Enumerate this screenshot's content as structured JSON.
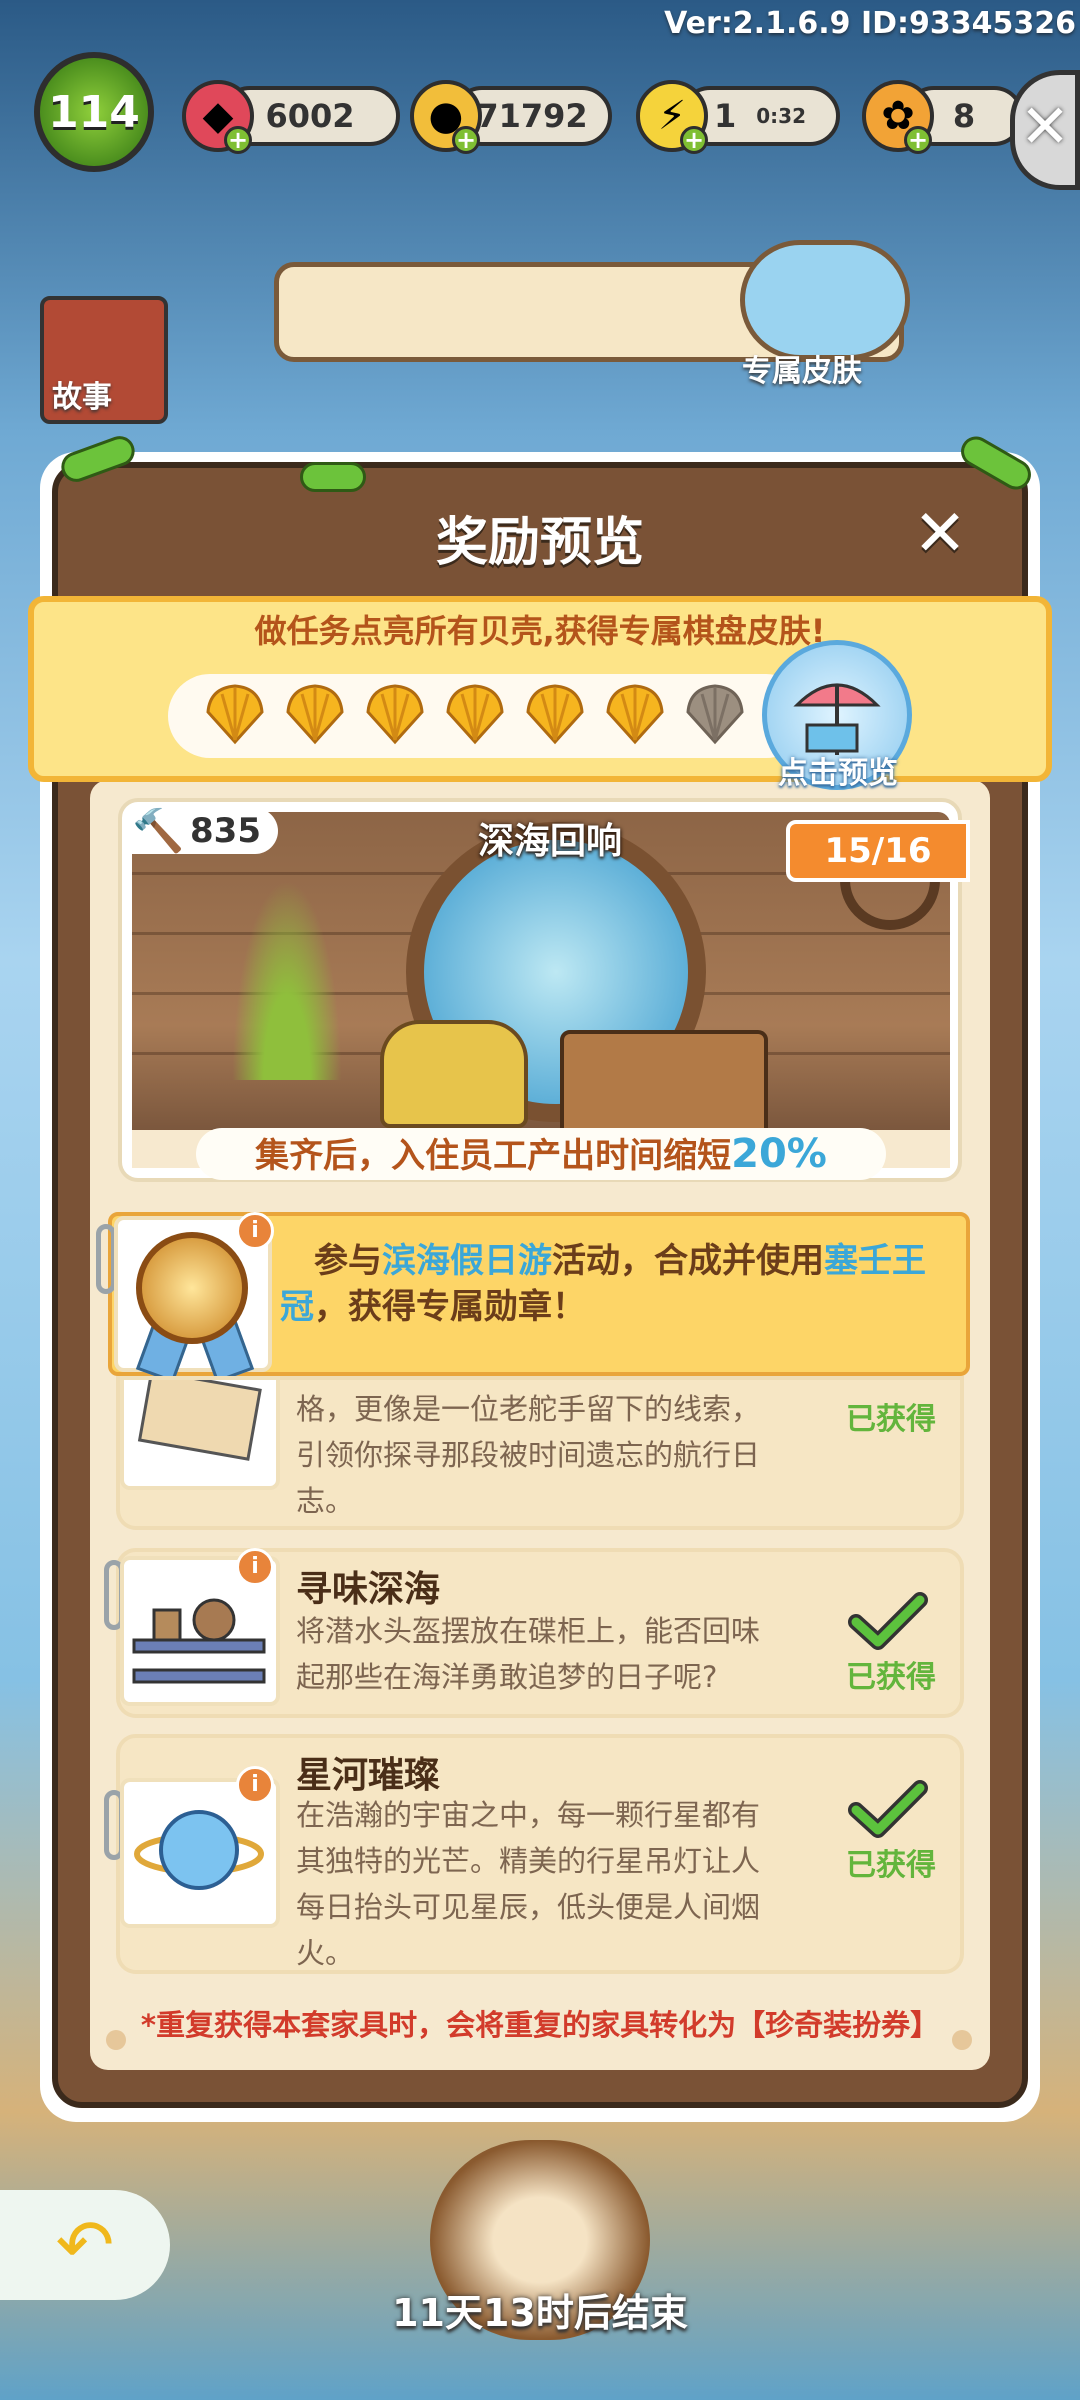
{
  "hud": {
    "version": "Ver:2.1.6.9 ID:93345326",
    "level": "114",
    "gems": "6002",
    "coins": "71792",
    "energy": "1",
    "energy_timer": "0:32",
    "clover": "8"
  },
  "background": {
    "story_label": "故事",
    "skin_label": "专属皮肤"
  },
  "modal": {
    "title": "奖励预览",
    "banner_text": "做任务点亮所有贝壳,获得专属棋盘皮肤!",
    "shells_lit": 6,
    "shells_total": 7,
    "preview_label": "点击预览",
    "set": {
      "coupon_count": "835",
      "name": "深海回响",
      "progress": "15/16",
      "bonus_text": "集齐后，入住员工产出时间缩短",
      "bonus_value": "20%"
    },
    "medal": {
      "text_1": "参与",
      "event_name": "滨海假日游",
      "text_2": "活动，合成并使用",
      "item_name": "塞壬王冠",
      "text_3": "，获得专属勋章！"
    },
    "items": [
      {
        "name": "",
        "desc_lines": [
          "格，更像是一位老舵手留下的线索，",
          "引领你探寻那段被时间遗忘的航行日",
          "志。"
        ],
        "status": "已获得"
      },
      {
        "name": "寻味深海",
        "desc_lines": [
          "将潜水头盔摆放在碟柜上，能否回味",
          "起那些在海洋勇敢追梦的日子呢?"
        ],
        "status": "已获得"
      },
      {
        "name": "星河璀璨",
        "desc_lines": [
          "在浩瀚的宇宙之中，每一颗行星都有",
          "其独特的光芒。精美的行星吊灯让人",
          "每日抬头可见星辰，低头便是人间烟",
          "火。"
        ],
        "status": "已获得"
      }
    ],
    "footer_note": "*重复获得本套家具时，会将重复的家具转化为【珍奇装扮券】"
  },
  "bottom": {
    "end_timer": "11天13时后结束"
  },
  "colors": {
    "accent_orange": "#f48b2e",
    "highlight_blue": "#3ba7d8",
    "obtained_green": "#63b53c",
    "frame_brown": "#7a5236"
  }
}
